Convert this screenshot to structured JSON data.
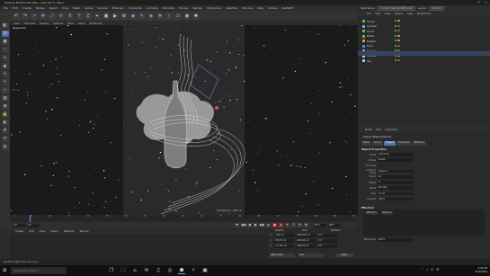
{
  "window": {
    "title": "Cinema 4D R21.207 (RC) - [p3.c4d *] - Main",
    "controls": [
      "–",
      "❐",
      "✕"
    ]
  },
  "menubar": [
    "File",
    "Edit",
    "Create",
    "Modes",
    "Select",
    "Tools",
    "Mesh",
    "Spline",
    "Volume",
    "MoGraph",
    "Character",
    "Animate",
    "Simulate",
    "Tracker",
    "Render",
    "Extensions",
    "Realflow",
    "Window",
    "Help",
    "Octane",
    "RedShift"
  ],
  "layout": {
    "label": "Node Space:",
    "node_value": "Current (Standard/Physical)",
    "layout_label": "Layout:",
    "layout_value": "Startup"
  },
  "top_toolbar": [
    {
      "icon": "undo-icon",
      "glyph": "↶",
      "tone": ""
    },
    {
      "icon": "redo-icon",
      "glyph": "↷",
      "tone": ""
    },
    {
      "icon": "select-icon",
      "glyph": "➚",
      "tone": "blue"
    },
    {
      "icon": "move-icon",
      "glyph": "✥",
      "tone": "blue"
    },
    {
      "icon": "scale-icon",
      "glyph": "⤢",
      "tone": "blue"
    },
    {
      "icon": "rotate-icon",
      "glyph": "⟳",
      "tone": "blue"
    },
    {
      "icon": "axis-x-icon",
      "glyph": "X",
      "tone": "orange"
    },
    {
      "icon": "axis-y-icon",
      "glyph": "Y",
      "tone": "green"
    },
    {
      "icon": "axis-z-icon",
      "glyph": "Z",
      "tone": "blue"
    },
    {
      "icon": "coordinate-icon",
      "glyph": "⌖",
      "tone": ""
    },
    {
      "icon": "render-view-icon",
      "glyph": "▣",
      "tone": ""
    },
    {
      "icon": "render-pv-icon",
      "glyph": "▶",
      "tone": ""
    },
    {
      "icon": "render-settings-icon",
      "glyph": "⚙",
      "tone": ""
    },
    {
      "icon": "cube-icon",
      "glyph": "◆",
      "tone": "blue"
    },
    {
      "icon": "pen-icon",
      "glyph": "✎",
      "tone": "blue"
    },
    {
      "icon": "subdivision-icon",
      "glyph": "◈",
      "tone": "green"
    },
    {
      "icon": "cloner-icon",
      "glyph": "❖",
      "tone": "green"
    },
    {
      "icon": "deformer-icon",
      "glyph": "⌇",
      "tone": "blue"
    },
    {
      "icon": "floor-icon",
      "glyph": "▭",
      "tone": ""
    },
    {
      "icon": "camera-icon",
      "glyph": "◉",
      "tone": ""
    },
    {
      "icon": "light-icon",
      "glyph": "✺",
      "tone": ""
    }
  ],
  "left_toolbar": [
    {
      "icon": "make-editable-icon",
      "glyph": "◧"
    },
    {
      "icon": "model-mode-icon",
      "glyph": "◳"
    },
    {
      "icon": "texture-mode-icon",
      "glyph": "▦"
    },
    {
      "icon": "points-mode-icon",
      "glyph": "⁘"
    },
    {
      "icon": "edges-mode-icon",
      "glyph": "◇"
    },
    {
      "icon": "polygons-mode-icon",
      "glyph": "▲"
    },
    {
      "icon": "axis-mode-icon",
      "glyph": "⊹"
    },
    {
      "icon": "tweak-icon",
      "glyph": "✧"
    },
    {
      "icon": "snap-icon",
      "glyph": "⌁"
    },
    {
      "icon": "workplane-icon",
      "glyph": "▤"
    },
    {
      "icon": "locked-workplane-icon",
      "glyph": "⊞"
    },
    {
      "icon": "lock-icon",
      "glyph": "🔒"
    },
    {
      "icon": "solo-icon",
      "glyph": "◐"
    },
    {
      "icon": "grid-icon",
      "glyph": "#"
    },
    {
      "icon": "brush-icon",
      "glyph": "✐"
    },
    {
      "icon": "sculpt-icon",
      "glyph": "◍"
    }
  ],
  "viewport": {
    "menu": [
      "View",
      "Cameras",
      "Display",
      "Options",
      "Filter",
      "Panel",
      "ProRender"
    ],
    "label": "Perspective",
    "grid_text": "Grid Spacing : 1000 cm"
  },
  "timeline": {
    "ticks": [
      "0",
      "5",
      "10",
      "15",
      "20",
      "25",
      "30",
      "35",
      "40",
      "45",
      "50",
      "55",
      "60",
      "65",
      "70",
      "75",
      "80",
      "85",
      "90"
    ],
    "start": "0 F",
    "current": "0 F",
    "end": "90 F",
    "end2": "90 F"
  },
  "transport": [
    "⏮",
    "◀◀",
    "◀",
    "▶",
    "▶▶",
    "⏭",
    "●",
    "⏺",
    "✦",
    "?",
    "⟳",
    "⊕"
  ],
  "material_manager": {
    "menu": [
      "Create",
      "Edit",
      "View",
      "Select",
      "Material",
      "Texture"
    ]
  },
  "coordinates": {
    "headers": [
      "Position",
      "Size",
      "Rotation"
    ],
    "rows": [
      {
        "axis": "X",
        "pos": "-3.45 cm",
        "size": "3492.004 cm",
        "rot": "H  0 °"
      },
      {
        "axis": "Y",
        "pos": "453.07 cm",
        "size": "4163.46 cm",
        "rot": "P  0 °"
      },
      {
        "axis": "Z",
        "pos": "-17.344 cm",
        "size": "3490.75 cm",
        "rot": "B  0 °"
      }
    ],
    "mode1": "Object (Rel)",
    "mode2": "Size",
    "apply": "Apply"
  },
  "status": "Realflow Object Preview done",
  "object_manager": {
    "menu": [
      "File",
      "Edit",
      "View",
      "Object",
      "Tags",
      "Bookmarks"
    ],
    "objects": [
      {
        "name": "Cloner",
        "color": "#5ec14f",
        "tags": [
          "g",
          "o"
        ]
      },
      {
        "name": "Cylinder",
        "color": "#6fa8ff",
        "tags": [
          "g",
          ""
        ]
      },
      {
        "name": "Tracer",
        "color": "#5ec14f",
        "tags": [
          "g",
          ""
        ]
      },
      {
        "name": "Matrix",
        "color": "#5ec14f",
        "tags": [
          "g",
          "o"
        ]
      },
      {
        "name": "Emitter",
        "color": "#e39a3a",
        "tags": [
          "g",
          "o"
        ]
      },
      {
        "name": "Fluid",
        "color": "#3b8ee0",
        "tags": [
          "g",
          ""
        ]
      },
      {
        "name": "Domain",
        "color": "#6fa8ff",
        "tags": [
          "g",
          ""
        ]
      },
      {
        "name": "Camera",
        "color": "#c9c9c9",
        "tags": [
          "g",
          "o"
        ]
      },
      {
        "name": "Sky",
        "color": "#9ad0ff",
        "tags": [
          "g",
          ""
        ]
      }
    ]
  },
  "attribute_manager": {
    "menu": [
      "Mode",
      "Edit",
      "User Data"
    ],
    "title": "Cloner Object [Cloner]",
    "tabs": [
      "Basic",
      "Coord.",
      "Object",
      "Transform",
      "Effectors"
    ],
    "active_tab": "Object",
    "section": "Object Properties",
    "rows": [
      {
        "key": "Mode",
        "value": "Grid Array"
      },
      {
        "key": "Clones",
        "value": "Iterate"
      },
      {
        "key": "Fix Clone",
        "value": "✓"
      },
      {
        "key": "Instance Mode",
        "value": "Instance"
      },
      {
        "key": "Count",
        "value": "10"
      },
      {
        "key": "Offset",
        "value": "0"
      },
      {
        "key": "Mode",
        "value": "Per Step"
      },
      {
        "key": "Size",
        "value": "11 cm"
      },
      {
        "key": "Amount",
        "value": "100 %"
      }
    ],
    "effectors_label": "Effectors",
    "effectors_buttons": [
      "Effectors",
      "Random"
    ],
    "resolution_label": "Resolution",
    "resolution_value": "100 %"
  },
  "taskbar": {
    "search": "Type here to search",
    "tasks": [
      "❐",
      "🗀",
      "⌂",
      "✉",
      "♫",
      "◎",
      "⬣",
      "⚡",
      "▣"
    ],
    "tray": [
      "⌃",
      "♪",
      "⊡",
      "☰"
    ],
    "time": "4:06 PM",
    "date": "6/14/2020"
  }
}
